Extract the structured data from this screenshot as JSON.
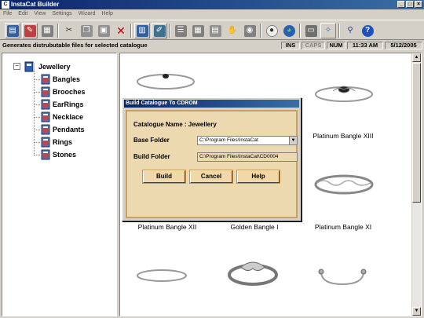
{
  "window": {
    "title": "InstaCat Builder",
    "controls": [
      "_",
      "□",
      "×"
    ]
  },
  "menu": [
    "File",
    "Edit",
    "View",
    "Settings",
    "Wizard",
    "Help"
  ],
  "status": {
    "message": "Generates distrubutable files for selected catalogue",
    "ins": "INS",
    "caps": "CAPS",
    "num": "NUM",
    "time": "11:33 AM",
    "date": "5/12/2005"
  },
  "tree": {
    "root": "Jewellery",
    "children": [
      "Bangles",
      "Brooches",
      "EarRings",
      "Necklace",
      "Pendants",
      "Rings",
      "Stones"
    ]
  },
  "gallery": {
    "labels": [
      "Platinum Bangle XIII",
      "Platinum Bangle XII",
      "Golden Bangle I",
      "Platinum Bangle XI"
    ]
  },
  "dialog": {
    "title": "Build Catalogue To CDROM",
    "catalogue_label": "Catalogue Name : Jewellery",
    "base_folder_label": "Base Folder",
    "base_folder_value": "C:\\Program Files\\InstaCat",
    "build_folder_label": "Build Folder",
    "build_folder_value": "C:\\Program Files\\InstaCat\\CD0004",
    "build_button": "Build",
    "cancel_button": "Cancel",
    "help_button": "Help"
  }
}
